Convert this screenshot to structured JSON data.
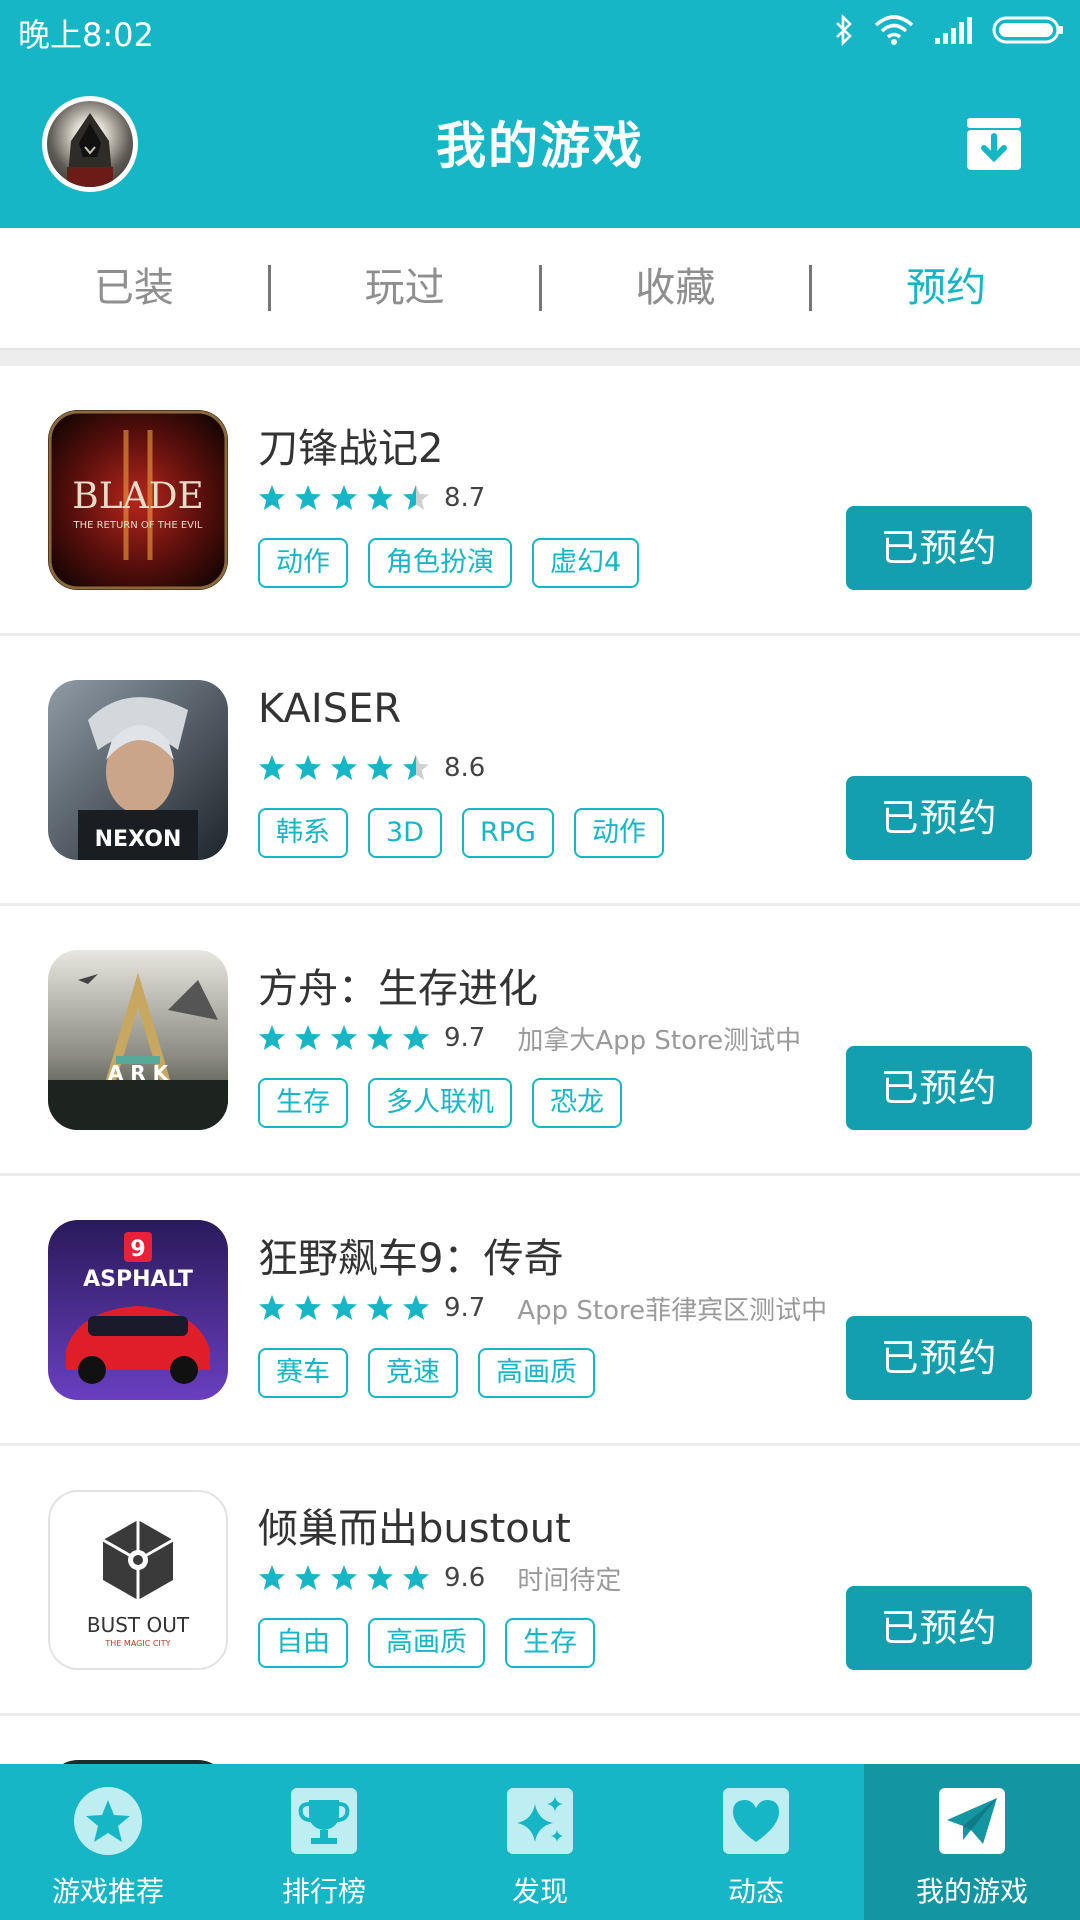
{
  "status_bar": {
    "time": "晚上8:02",
    "icons": [
      "bluetooth-icon",
      "wifi-icon",
      "signal-icon",
      "battery-icon"
    ]
  },
  "header": {
    "title": "我的游戏",
    "avatar": "avatar",
    "right_icon": "download-box-icon"
  },
  "tabs": [
    {
      "label": "已装",
      "active": false
    },
    {
      "label": "玩过",
      "active": false
    },
    {
      "label": "收藏",
      "active": false
    },
    {
      "label": "预约",
      "active": true
    }
  ],
  "games": [
    {
      "name": "刀锋战记2",
      "rating": "8.7",
      "stars": 4.5,
      "note": "",
      "tags": [
        "动作",
        "角色扮演",
        "虚幻4"
      ],
      "button": "已预约",
      "icon": "blade-game-icon",
      "icon_text": "BLADE",
      "icon_subtext": "THE RETURN OF THE EVIL"
    },
    {
      "name": "KAISER",
      "rating": "8.6",
      "stars": 4.5,
      "note": "",
      "tags": [
        "韩系",
        "3D",
        "RPG",
        "动作"
      ],
      "button": "已预约",
      "icon": "kaiser-game-icon",
      "icon_text": "NEXON",
      "icon_subtext": ""
    },
    {
      "name": "方舟：生存进化",
      "rating": "9.7",
      "stars": 5,
      "note": "加拿大App Store测试中",
      "tags": [
        "生存",
        "多人联机",
        "恐龙"
      ],
      "button": "已预约",
      "icon": "ark-game-icon",
      "icon_text": "A R K",
      "icon_subtext": ""
    },
    {
      "name": "狂野飙车9：传奇",
      "rating": "9.7",
      "stars": 5,
      "note": "App Store菲律宾区测试中",
      "tags": [
        "赛车",
        "竞速",
        "高画质"
      ],
      "button": "已预约",
      "icon": "asphalt-game-icon",
      "icon_text": "ASPHALT",
      "icon_subtext": "9"
    },
    {
      "name": "倾巢而出bustout",
      "rating": "9.6",
      "stars": 5,
      "note": "时间待定",
      "tags": [
        "自由",
        "高画质",
        "生存"
      ],
      "button": "已预约",
      "icon": "bustout-game-icon",
      "icon_text": "BUST OUT",
      "icon_subtext": "THE MAGIC CITY"
    }
  ],
  "bottom_nav": [
    {
      "label": "游戏推荐",
      "icon": "star-icon",
      "active": false
    },
    {
      "label": "排行榜",
      "icon": "trophy-icon",
      "active": false
    },
    {
      "label": "发现",
      "icon": "sparkle-icon",
      "active": false
    },
    {
      "label": "动态",
      "icon": "heart-icon",
      "active": false
    },
    {
      "label": "我的游戏",
      "icon": "paper-plane-icon",
      "active": true
    }
  ],
  "colors": {
    "accent": "#17b6c6",
    "button": "#139fad",
    "nav_active": "#1396a2",
    "tag": "#17b6c6",
    "star_empty": "#d0d0d0"
  }
}
